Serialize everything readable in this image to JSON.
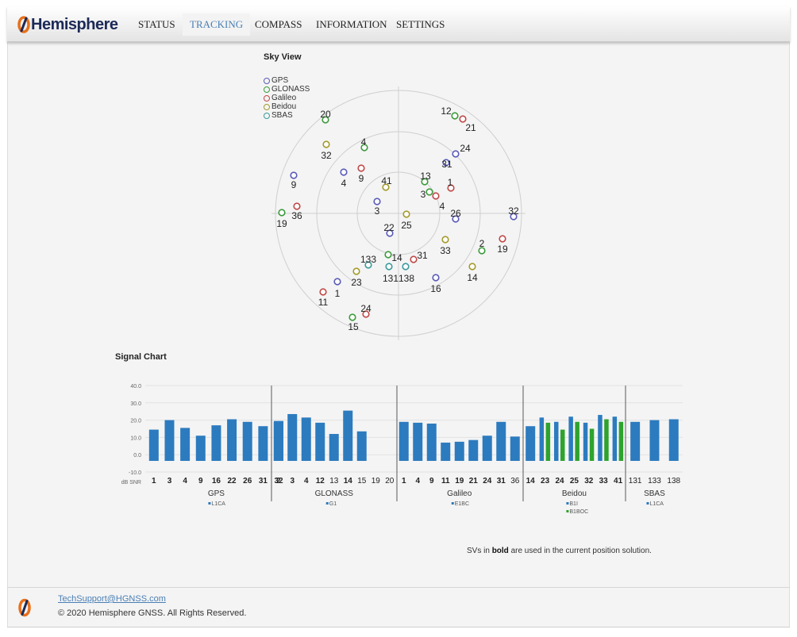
{
  "brand": {
    "name": "Hemisphere",
    "logo_color": "#e8701a",
    "text_color": "#1c2a57"
  },
  "nav": {
    "items": [
      {
        "label": "STATUS"
      },
      {
        "label": "TRACKING",
        "active": true
      },
      {
        "label": "COMPASS"
      },
      {
        "label": "INFORMATION"
      },
      {
        "label": "SETTINGS"
      }
    ],
    "active_color": "#4a7fb5"
  },
  "sky_view": {
    "title": "Sky View",
    "legend": [
      {
        "label": "GPS",
        "color": "#5a5ab8"
      },
      {
        "label": "GLONASS",
        "color": "#3c9a3c"
      },
      {
        "label": "Galileo",
        "color": "#c04848"
      },
      {
        "label": "Beidou",
        "color": "#a39a2a"
      },
      {
        "label": "SBAS",
        "color": "#3a9a9a"
      }
    ],
    "satellites": [
      {
        "label": "20",
        "sys": "GLONASS"
      },
      {
        "label": "12",
        "sys": "GLONASS"
      },
      {
        "label": "21",
        "sys": "Galileo"
      },
      {
        "label": "24",
        "sys": "GPS"
      },
      {
        "label": "31",
        "sys": "GPS"
      },
      {
        "label": "32",
        "sys": "Beidou"
      },
      {
        "label": "4",
        "sys": "GLONASS"
      },
      {
        "label": "9",
        "sys": "GPS"
      },
      {
        "label": "4",
        "sys": "GPS"
      },
      {
        "label": "9",
        "sys": "Galileo"
      },
      {
        "label": "41",
        "sys": "Beidou"
      },
      {
        "label": "13",
        "sys": "GLONASS"
      },
      {
        "label": "1",
        "sys": "Galileo"
      },
      {
        "label": "3",
        "sys": "GLONASS"
      },
      {
        "label": "4",
        "sys": "Galileo"
      },
      {
        "label": "3",
        "sys": "GPS"
      },
      {
        "label": "36",
        "sys": "Galileo"
      },
      {
        "label": "19",
        "sys": "GLONASS"
      },
      {
        "label": "26",
        "sys": "GPS"
      },
      {
        "label": "32",
        "sys": "GPS"
      },
      {
        "label": "22",
        "sys": "GPS"
      },
      {
        "label": "25",
        "sys": "Beidou"
      },
      {
        "label": "2",
        "sys": "GLONASS"
      },
      {
        "label": "19",
        "sys": "Galileo"
      },
      {
        "label": "33",
        "sys": "Beidou"
      },
      {
        "label": "133",
        "sys": "SBAS"
      },
      {
        "label": "14",
        "sys": "GLONASS"
      },
      {
        "label": "31",
        "sys": "Galileo"
      },
      {
        "label": "131",
        "sys": "SBAS"
      },
      {
        "label": "138",
        "sys": "SBAS"
      },
      {
        "label": "23",
        "sys": "Beidou"
      },
      {
        "label": "14",
        "sys": "Beidou"
      },
      {
        "label": "16",
        "sys": "GPS"
      },
      {
        "label": "1",
        "sys": "GPS"
      },
      {
        "label": "11",
        "sys": "Galileo"
      },
      {
        "label": "24",
        "sys": "Galileo"
      },
      {
        "label": "15",
        "sys": "GLONASS"
      }
    ]
  },
  "signal_chart": {
    "title": "Signal Chart",
    "bar_color": "#2c7bbf",
    "second_color": "#2ea32e",
    "ylabel": "dB SNR",
    "yticks": [
      "40.0",
      "30.0",
      "20.0",
      "10.0",
      "0.0",
      "-10.0"
    ],
    "ylim": [
      -10,
      40
    ],
    "groups": [
      {
        "name": "GPS",
        "legend": [
          "L1CA"
        ],
        "svs": [
          "1",
          "3",
          "4",
          "9",
          "16",
          "22",
          "26",
          "31",
          "32"
        ],
        "values": [
          14.5,
          20,
          15.5,
          11,
          17,
          20.5,
          19,
          16.5,
          19.5
        ]
      },
      {
        "name": "GLONASS",
        "legend": [
          "G1"
        ],
        "svs": [
          "2",
          "3",
          "4",
          "12",
          "13",
          "14",
          "15",
          "19",
          "20"
        ],
        "values": [
          19,
          23.5,
          21.5,
          18.5,
          12,
          25.5,
          13.5,
          null,
          null
        ]
      },
      {
        "name": "Galileo",
        "legend": [
          "E1BC"
        ],
        "svs": [
          "1",
          "4",
          "9",
          "11",
          "19",
          "21",
          "24",
          "31",
          "36"
        ],
        "values": [
          19,
          18.5,
          18,
          7,
          7.5,
          8.5,
          11,
          19,
          10.5
        ]
      },
      {
        "name": "Beidou",
        "legend": [
          "B1I",
          "B1BOC"
        ],
        "svs": [
          "14",
          "23",
          "24",
          "25",
          "32",
          "33",
          "41"
        ],
        "values": [
          16.5,
          21.5,
          19,
          22,
          18.5,
          23,
          22
        ],
        "values2": [
          null,
          18.5,
          14.5,
          19,
          15,
          20.5,
          19
        ]
      },
      {
        "name": "SBAS",
        "legend": [
          "L1CA"
        ],
        "svs": [
          "131",
          "133",
          "138"
        ],
        "values": [
          19,
          20,
          20.5
        ]
      }
    ],
    "bold_svs": {
      "GPS": [
        "1",
        "3",
        "4",
        "9",
        "16",
        "22",
        "26",
        "31",
        "32"
      ],
      "GLONASS": [
        "2",
        "3",
        "4",
        "12",
        "14"
      ],
      "Galileo": [
        "1",
        "4",
        "9",
        "11",
        "19",
        "21",
        "24",
        "31"
      ],
      "Beidou": [
        "14",
        "23",
        "24",
        "25",
        "32",
        "33",
        "41"
      ],
      "SBAS": []
    }
  },
  "note": {
    "prefix": "SVs in ",
    "bold": "bold",
    "suffix": " are used in the current position solution."
  },
  "footer": {
    "support_email": "TechSupport@HGNSS.com",
    "copyright": "© 2020 Hemisphere GNSS. All Rights Reserved."
  }
}
